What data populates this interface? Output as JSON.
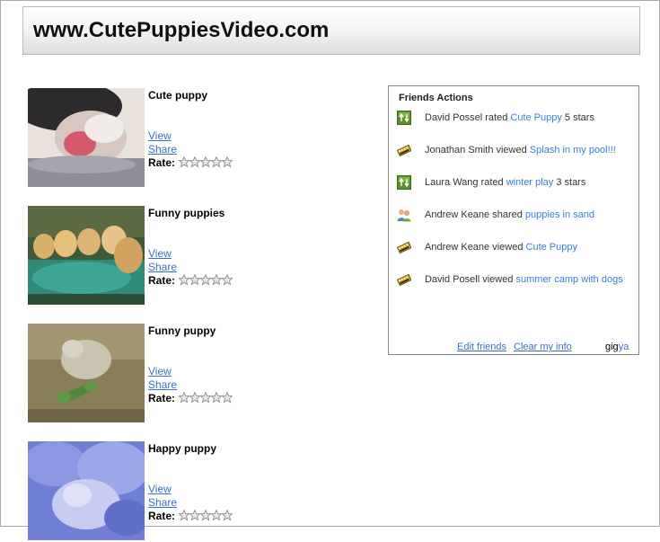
{
  "site": {
    "title": "www.CutePuppiesVideo.com"
  },
  "videos": [
    {
      "title": "Cute puppy",
      "view_label": "View",
      "share_label": "Share",
      "rate_label": "Rate:",
      "rating_stars_filled": 0,
      "rating_stars_total": 5
    },
    {
      "title": "Funny puppies",
      "view_label": "View",
      "share_label": "Share",
      "rate_label": "Rate:",
      "rating_stars_filled": 0,
      "rating_stars_total": 5
    },
    {
      "title": "Funny puppy",
      "view_label": "View",
      "share_label": "Share",
      "rate_label": "Rate:",
      "rating_stars_filled": 0,
      "rating_stars_total": 5
    },
    {
      "title": "Happy puppy",
      "view_label": "View",
      "share_label": "Share",
      "rate_label": "Rate:",
      "rating_stars_filled": 0,
      "rating_stars_total": 5
    }
  ],
  "friends": {
    "title": "Friends Actions",
    "actions": [
      {
        "icon": "rate-icon",
        "before": "David Possel rated ",
        "link": "Cute Puppy",
        "after": " 5 stars"
      },
      {
        "icon": "film-icon",
        "before": "Jonathan Smith viewed ",
        "link": "Splash in my pool!!!",
        "after": ""
      },
      {
        "icon": "rate-icon",
        "before": "Laura Wang rated ",
        "link": "winter play",
        "after": " 3 stars"
      },
      {
        "icon": "share-people-icon",
        "before": "Andrew Keane shared ",
        "link": "puppies in sand",
        "after": ""
      },
      {
        "icon": "film-icon",
        "before": "Andrew Keane viewed ",
        "link": "Cute Puppy",
        "after": ""
      },
      {
        "icon": "film-icon",
        "before": "David Posell viewed ",
        "link": "summer camp with dogs",
        "after": ""
      }
    ],
    "edit_label": "Edit friends",
    "clear_label": "Clear my info",
    "logo_gig": "gig",
    "logo_ya": "ya"
  },
  "colors": {
    "link": "#3b7dd8",
    "panel_border": "#8a8a8a"
  }
}
